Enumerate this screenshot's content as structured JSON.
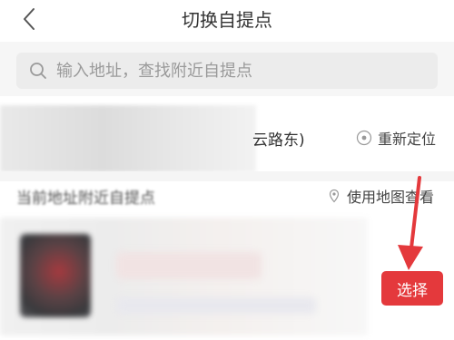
{
  "header": {
    "back_icon": "chevron-left-icon",
    "title": "切换自提点"
  },
  "search": {
    "icon": "search-icon",
    "placeholder": "输入地址，查找附近自提点"
  },
  "current_location": {
    "address_visible": "云路东)",
    "relocate_icon": "locate-icon",
    "relocate_label": "重新定位"
  },
  "nearby": {
    "label": "当前地址附近自提点",
    "map_icon": "map-pin-icon",
    "map_label": "使用地图查看"
  },
  "store": {
    "select_label": "选择"
  },
  "colors": {
    "accent": "#e4393c",
    "arrow": "#e4393c"
  }
}
